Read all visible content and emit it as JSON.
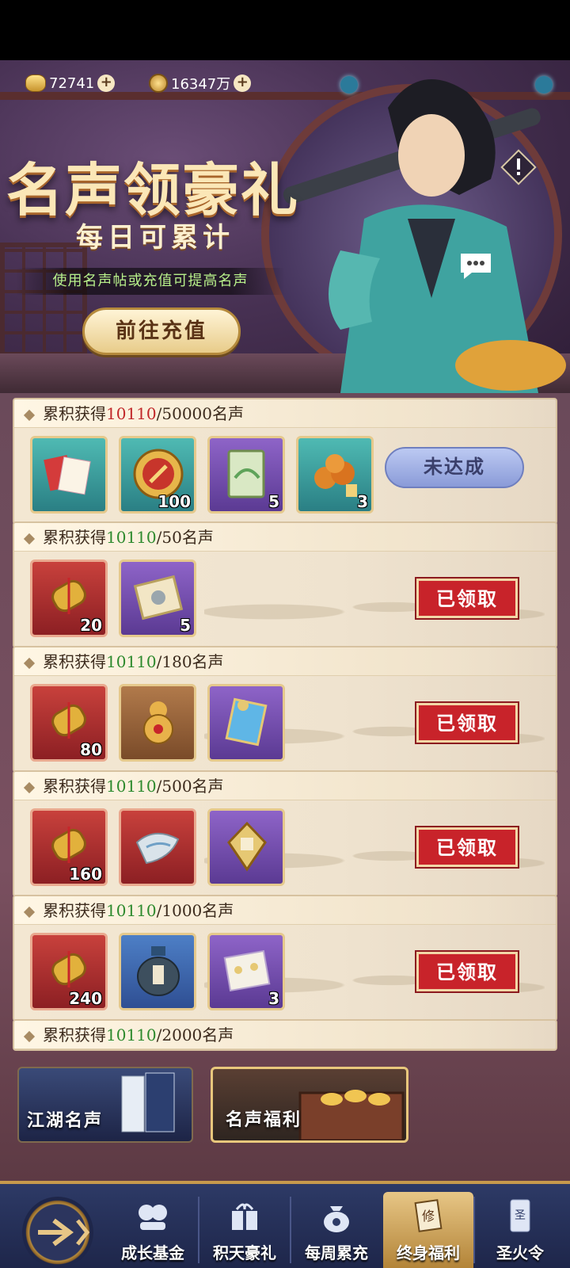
{
  "currencies": {
    "gold": "72741",
    "copper": "16347万"
  },
  "banner": {
    "title": "名声领豪礼",
    "subtitle": "每日可累计",
    "hint": "使用名声帖或充值可提高名声",
    "recharge_button": "前往充值"
  },
  "milestones": [
    {
      "prefix": "累积获得",
      "current": "10110",
      "target": "/50000名声",
      "status": "未达成",
      "reached": false,
      "rewards": [
        {
          "icon": "red-envelopes-icon",
          "qty": ""
        },
        {
          "icon": "golden-token-icon",
          "qty": "100"
        },
        {
          "icon": "green-book-icon",
          "qty": "5"
        },
        {
          "icon": "orange-orbs-icon",
          "qty": "3"
        }
      ]
    },
    {
      "prefix": "累积获得",
      "current": "10110",
      "target": "/50名声",
      "status": "已领取",
      "reached": true,
      "rewards": [
        {
          "icon": "golden-scroll-icon",
          "qty": "20"
        },
        {
          "icon": "silver-talisman-icon",
          "qty": "5"
        }
      ]
    },
    {
      "prefix": "累积获得",
      "current": "10110",
      "target": "/180名声",
      "status": "已领取",
      "reached": true,
      "rewards": [
        {
          "icon": "golden-scroll-icon",
          "qty": "80"
        },
        {
          "icon": "golden-gourd-icon",
          "qty": ""
        },
        {
          "icon": "blue-scroll-icon",
          "qty": ""
        }
      ]
    },
    {
      "prefix": "累积获得",
      "current": "10110",
      "target": "/500名声",
      "status": "已领取",
      "reached": true,
      "rewards": [
        {
          "icon": "golden-scroll-icon",
          "qty": "160"
        },
        {
          "icon": "silk-cloth-icon",
          "qty": ""
        },
        {
          "icon": "golden-charm-icon",
          "qty": ""
        }
      ]
    },
    {
      "prefix": "累积获得",
      "current": "10110",
      "target": "/1000名声",
      "status": "已领取",
      "reached": true,
      "rewards": [
        {
          "icon": "golden-scroll-icon",
          "qty": "240"
        },
        {
          "icon": "wine-jar-icon",
          "qty": ""
        },
        {
          "icon": "white-scroll-icon",
          "qty": "3"
        }
      ]
    },
    {
      "prefix": "累积获得",
      "current": "10110",
      "target": "/2000名声",
      "status": "",
      "reached": true,
      "rewards": []
    }
  ],
  "sub_tabs": [
    {
      "label": "江湖名声"
    },
    {
      "label": "名声福利"
    }
  ],
  "bottom_nav": [
    {
      "label": "成长基金",
      "icon": "coins-icon"
    },
    {
      "label": "积天豪礼",
      "icon": "gift-box-icon"
    },
    {
      "label": "每周累充",
      "icon": "money-bag-icon"
    },
    {
      "label": "终身福利",
      "icon": "lifetime-card-icon",
      "active": true
    },
    {
      "label": "圣火令",
      "icon": "holy-fire-token-icon"
    }
  ]
}
